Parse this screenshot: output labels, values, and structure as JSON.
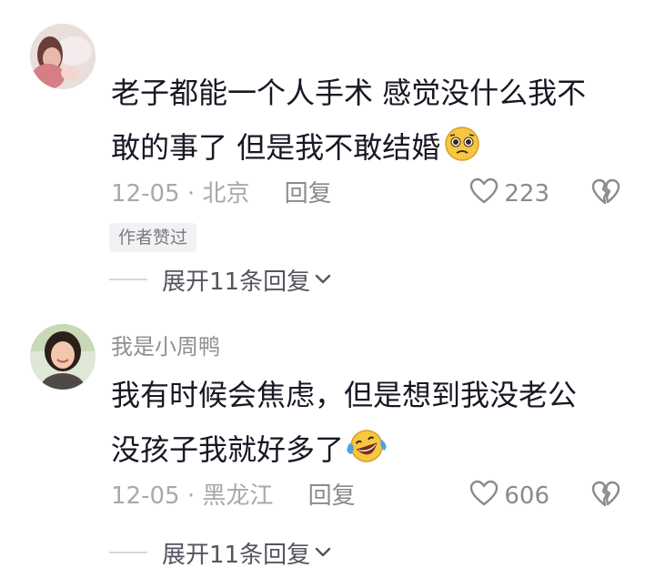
{
  "comments": [
    {
      "username": "",
      "lines": [
        "老子都能一个人手术 感觉没什么我不",
        "敢的事了 但是我不敢结婚"
      ],
      "emoji": "pleading-face-emoji",
      "date": "12-05",
      "separator": "·",
      "location": "北京",
      "reply_label": "回复",
      "like_count": "223",
      "author_badge": "作者赞过",
      "expand_label": "展开11条回复"
    },
    {
      "username": "我是小周鸭",
      "lines": [
        "我有时候会焦虑，但是想到我没老公",
        "没孩子我就好多了"
      ],
      "emoji": "laughing-tears-emoji",
      "date": "12-05",
      "separator": "·",
      "location": "黑龙江",
      "reply_label": "回复",
      "like_count": "606",
      "expand_label": "展开11条回复"
    }
  ],
  "icons": {
    "like": "heart-outline-icon",
    "dislike": "broken-heart-icon",
    "expand": "chevron-down-icon"
  },
  "colors": {
    "text": "#161823",
    "meta": "#a8a8ad",
    "badge_bg": "#f2f2f4",
    "emoji_yellow": "#f7c742"
  }
}
